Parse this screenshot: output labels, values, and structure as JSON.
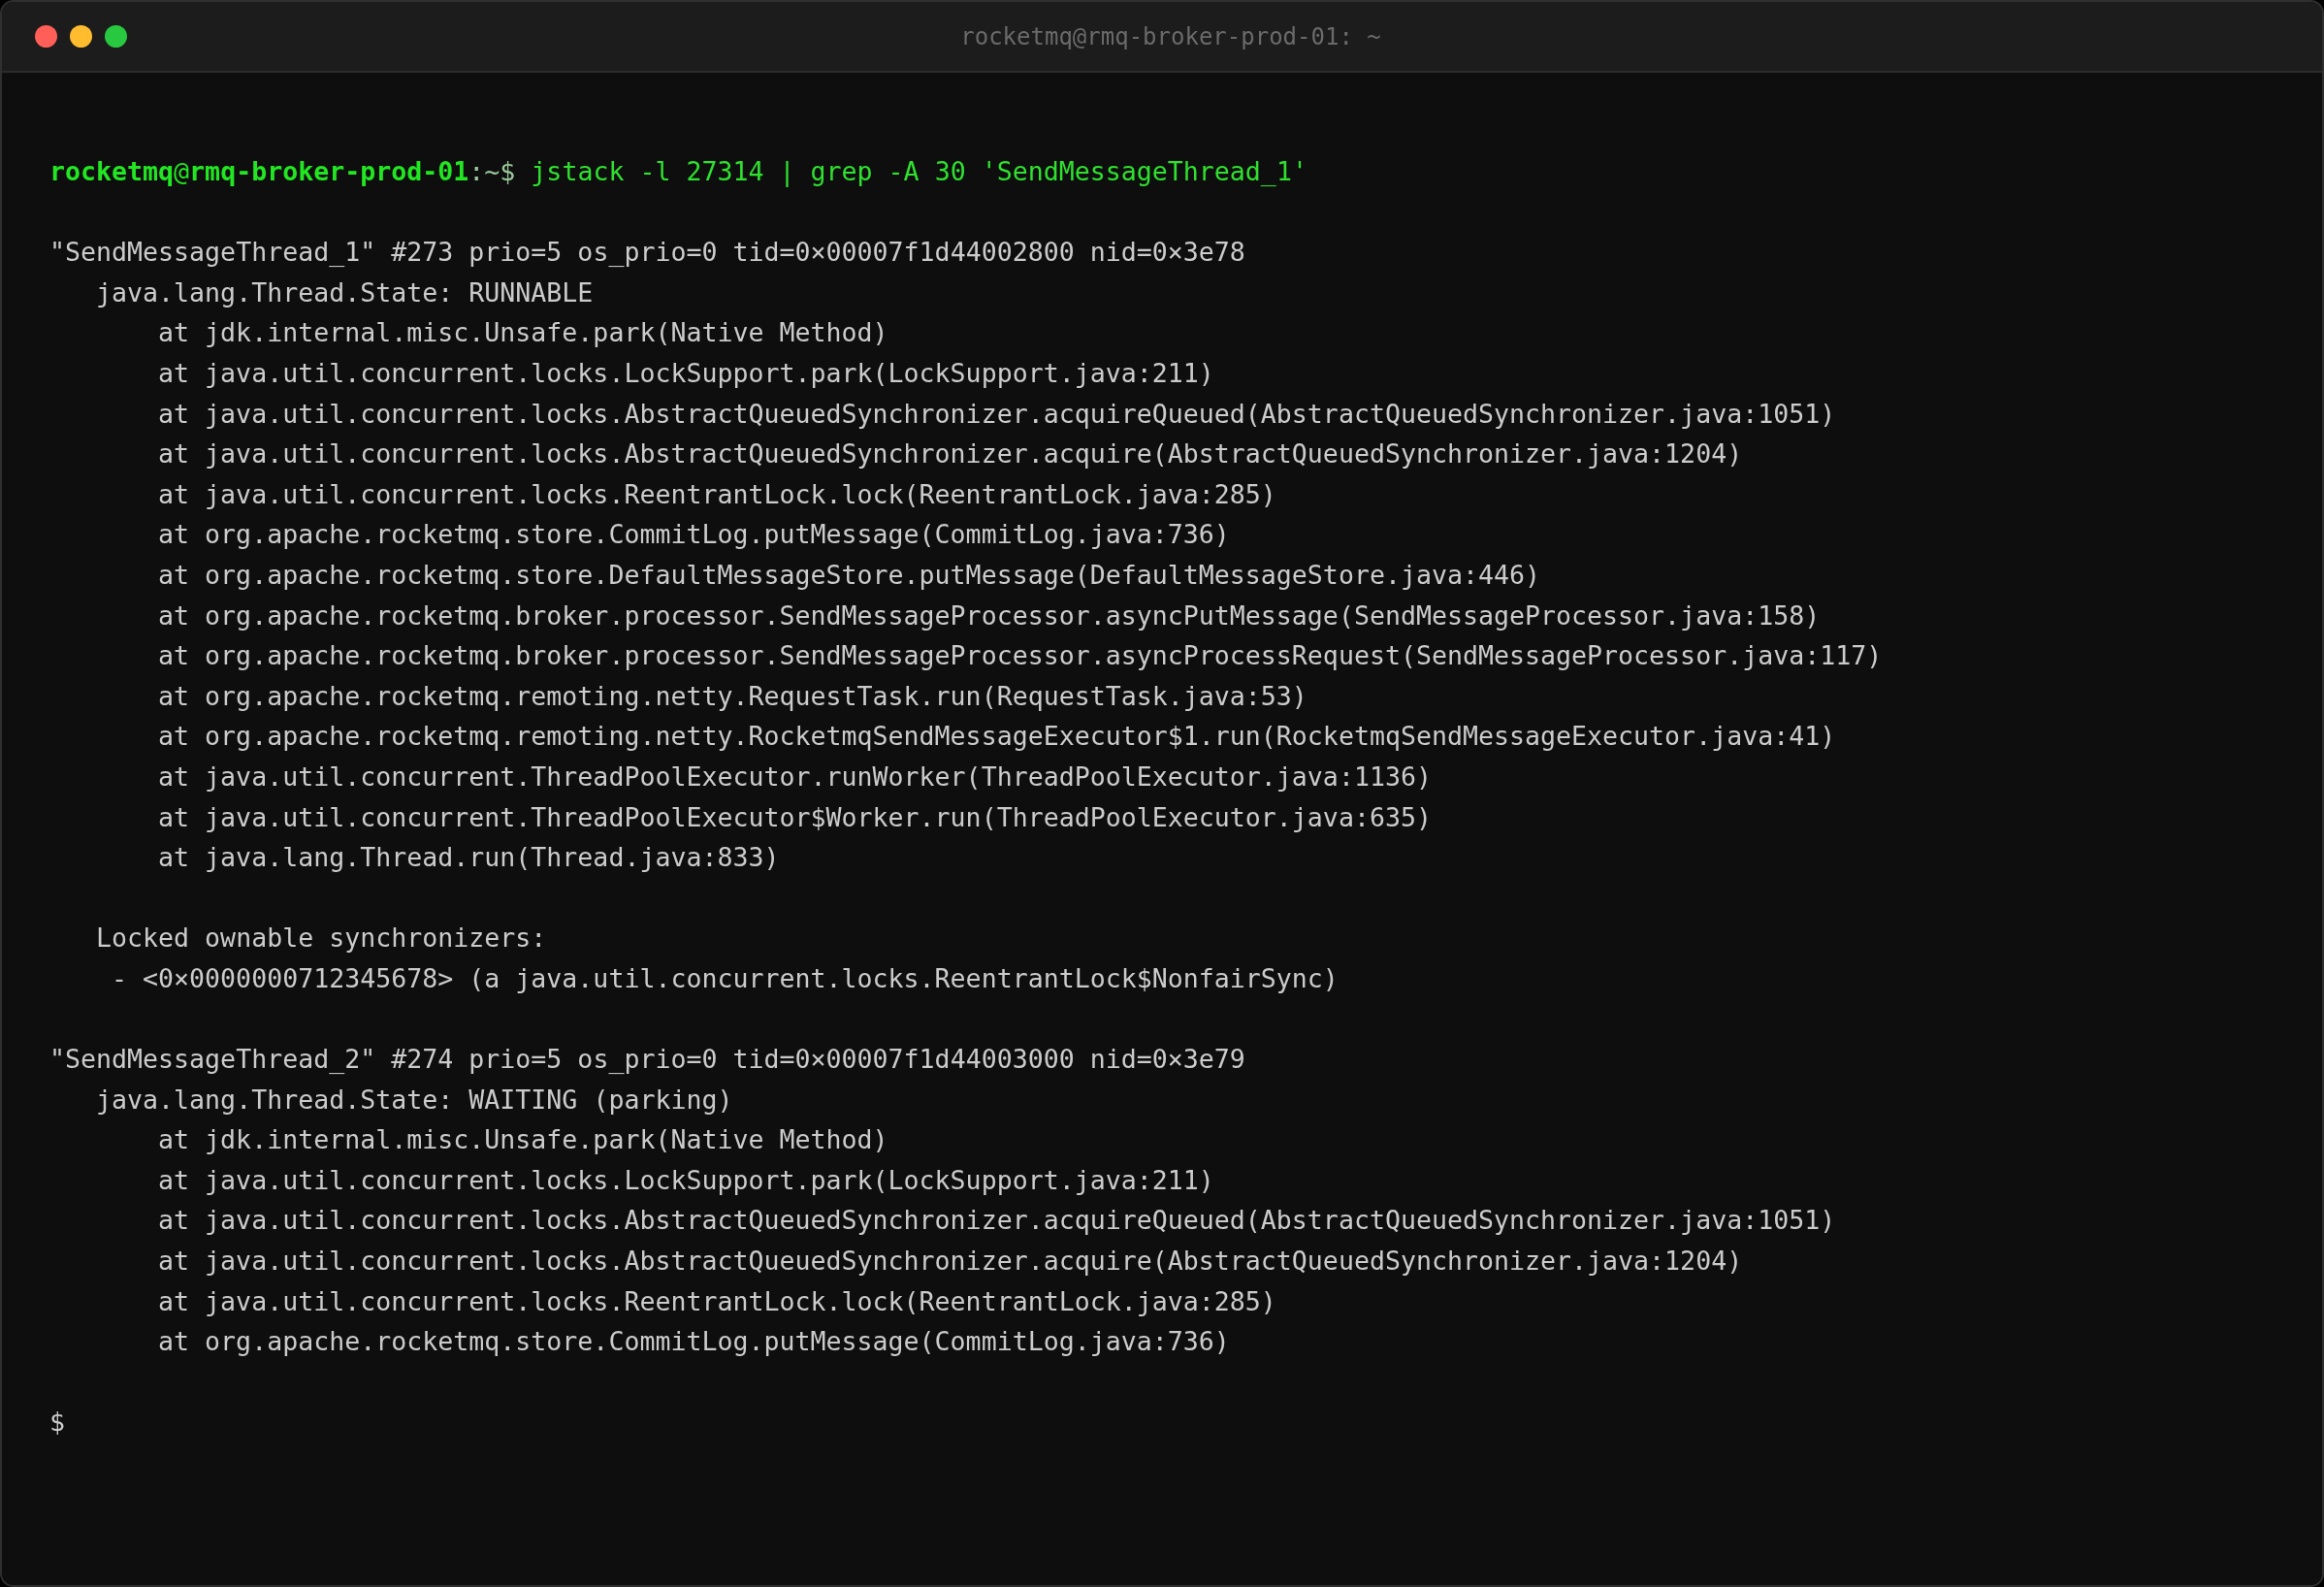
{
  "window": {
    "title": "rocketmq@rmq-broker-prod-01: ~",
    "buttons": [
      {
        "kind": "close"
      },
      {
        "kind": "minimize"
      },
      {
        "kind": "zoom"
      }
    ]
  },
  "terminal": {
    "prompt": {
      "user_host": "**rocketmq**@**rmq-broker-prod-01**",
      "cwd": ":~$",
      "command": "jstack -l 27314 | grep -A 30 'SendMessageThread_1'"
    },
    "threads": [
      {
        "header": "\"SendMessageThread_1\" #273 prio=5 os_prio=0 tid=0×00007f1d44002800 nid=0×3e78",
        "state": "java.lang.Thread.State: RUNNABLE",
        "frames": [
          "at jdk.internal.misc.Unsafe.park(Native Method)",
          "at java.util.concurrent.locks.LockSupport.park(LockSupport.java:211)",
          "at java.util.concurrent.locks.AbstractQueuedSynchronizer.acquireQueued(AbstractQueuedSynchronizer.java:1051)",
          "at java.util.concurrent.locks.AbstractQueuedSynchronizer.acquire(AbstractQueuedSynchronizer.java:1204)",
          "at java.util.concurrent.locks.ReentrantLock.lock(ReentrantLock.java:285)",
          "at org.apache.rocketmq.store.CommitLog.putMessage(CommitLog.java:736)",
          "at org.apache.rocketmq.store.DefaultMessageStore.putMessage(DefaultMessageStore.java:446)",
          "at org.apache.rocketmq.broker.processor.SendMessageProcessor.asyncPutMessage(SendMessageProcessor.java:158)",
          "at org.apache.rocketmq.broker.processor.SendMessageProcessor.asyncProcessRequest(SendMessageProcessor.java:117)",
          "at org.apache.rocketmq.remoting.netty.RequestTask.run(RequestTask.java:53)",
          "at org.apache.rocketmq.remoting.netty.RocketmqSendMessageExecutor$1.run(RocketmqSendMessageExecutor.java:41)",
          "at java.util.concurrent.ThreadPoolExecutor.runWorker(ThreadPoolExecutor.java:1136)",
          "at java.util.concurrent.ThreadPoolExecutor$Worker.run(ThreadPoolExecutor.java:635)",
          "at java.lang.Thread.run(Thread.java:833)"
        ],
        "locked_synchronizers": {
          "title": "Locked ownable synchronizers:",
          "items": [
            "- <0×0000000712345678> (a java.util.concurrent.locks.ReentrantLock$NonfairSync)"
          ]
        }
      },
      {
        "header": "\"SendMessageThread_2\" #274 prio=5 os_prio=0 tid=0×00007f1d44003000 nid=0×3e79",
        "state": "java.lang.Thread.State: WAITING (parking)",
        "frames": [
          "at jdk.internal.misc.Unsafe.park(Native Method)",
          "at java.util.concurrent.locks.LockSupport.park(LockSupport.java:211)",
          "at java.util.concurrent.locks.AbstractQueuedSynchronizer.acquireQueued(AbstractQueuedSynchronizer.java:1051)",
          "at java.util.concurrent.locks.AbstractQueuedSynchronizer.acquire(AbstractQueuedSynchronizer.java:1204)",
          "at java.util.concurrent.locks.ReentrantLock.lock(ReentrantLock.java:285)",
          "at org.apache.rocketmq.store.CommitLog.putMessage(CommitLog.java:736)"
        ]
      }
    ],
    "next_prompt": "$"
  }
}
